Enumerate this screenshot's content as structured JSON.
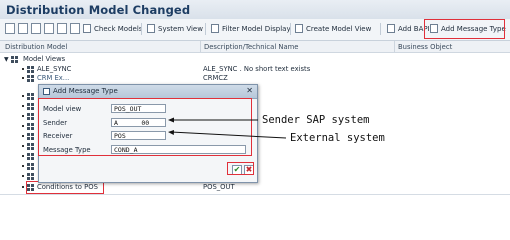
{
  "window": {
    "title": "Distribution Model Changed"
  },
  "toolbar": {
    "buttons": [
      "Check Models",
      "System View",
      "Filter Model Display",
      "Create Model View",
      "Add BAPI",
      "Add Message Type"
    ]
  },
  "columns": [
    "Distribution Model",
    "Description/Technical Name",
    "Business Object"
  ],
  "tree": {
    "root": "Model Views",
    "ale_sync": "ALE_SYNC",
    "ale_sync_desc": "ALE_SYNC . No short text exists",
    "crm_partial": "CRM Ex...",
    "crm_partial_desc": "CRMCZ",
    "conditions": "Conditions to POS",
    "conditions_desc": "POS_OUT"
  },
  "dialog": {
    "title": "Add Message Type",
    "fields": [
      {
        "label": "Model view",
        "value": "POS_OUT"
      },
      {
        "label": "Sender",
        "value": "A      00"
      },
      {
        "label": "Receiver",
        "value": "POS"
      },
      {
        "label": "Message Type",
        "value": "COND_A"
      }
    ]
  },
  "annotations": {
    "sender": "Sender SAP system",
    "receiver": "External system"
  },
  "colors": {
    "highlight": "#e0303a",
    "title": "#1d3d63"
  }
}
